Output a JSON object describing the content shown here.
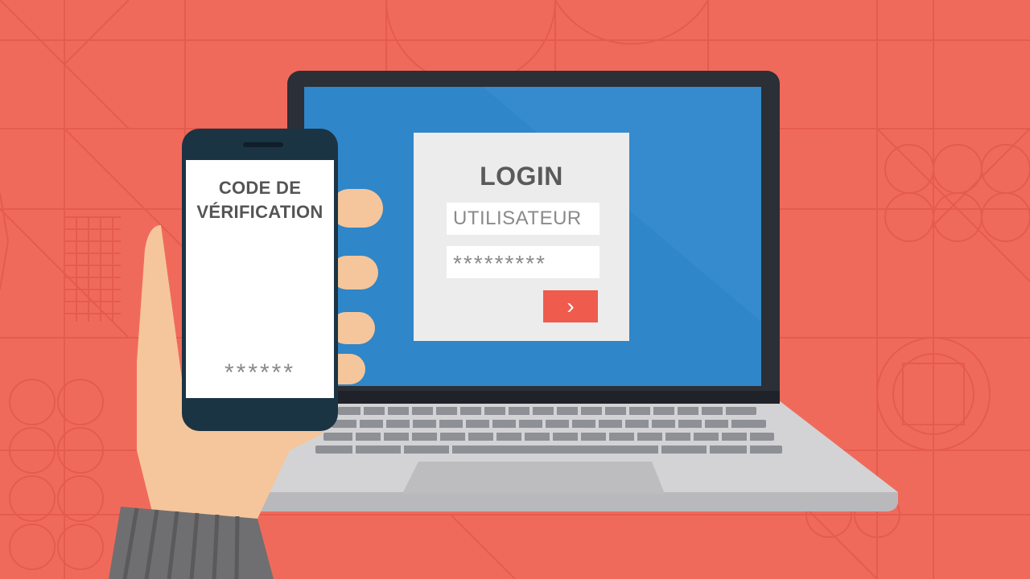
{
  "colors": {
    "background": "#f06a5b",
    "accent": "#ef5b4d",
    "laptop_screen": "#2f86c9",
    "laptop_bezel": "#2b2f36",
    "phone_body": "#1b3444"
  },
  "laptop": {
    "login_title": "LOGIN",
    "username_placeholder": "UTILISATEUR",
    "password_value": "*********",
    "submit_icon": "chevron-right-icon"
  },
  "phone": {
    "title": "CODE DE VÉRIFICATION",
    "code_masked": "******",
    "icon": "padlock-icon"
  }
}
